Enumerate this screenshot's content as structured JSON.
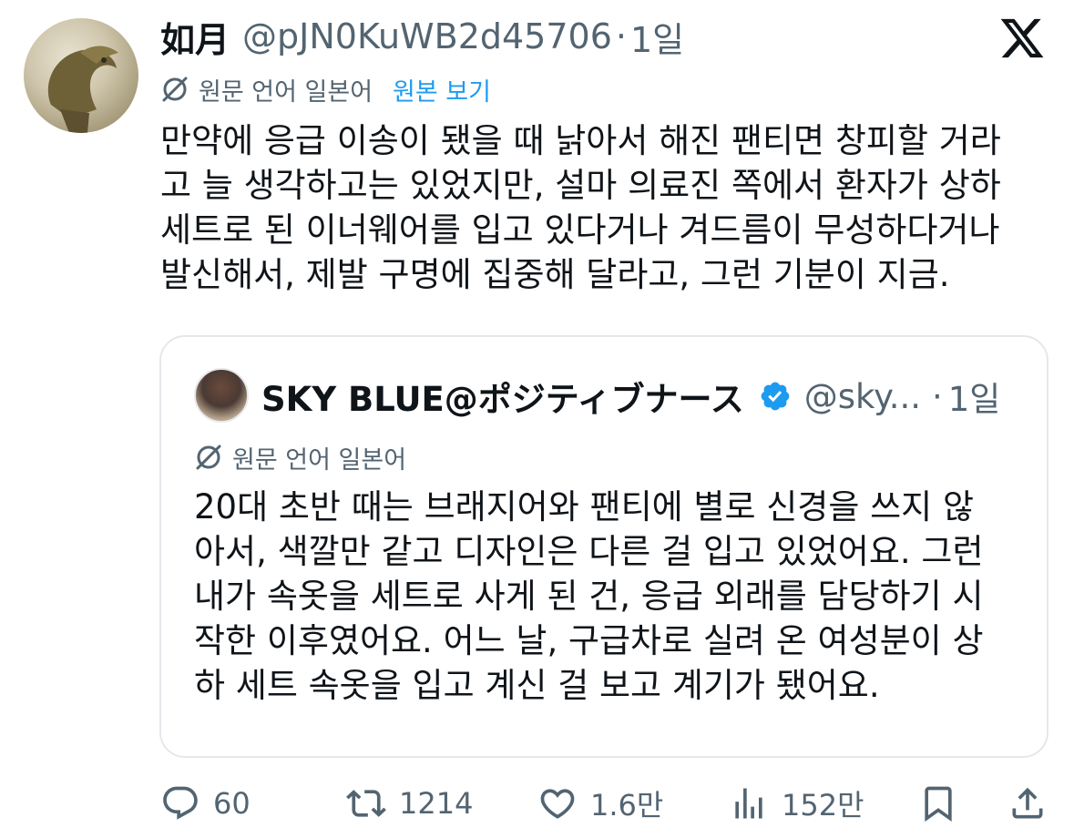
{
  "tweet": {
    "author_name": "如月",
    "handle": "@pJN0KuWB2d45706",
    "separator": "·",
    "time": "1일",
    "translation": {
      "label": "원문 언어 일본어",
      "view_original": "원본 보기"
    },
    "body_lines": [
      "만약에 응급 이송이 됐을 때 낡아서 해진 팬티면 창피할 거라",
      "고 늘 생각하고는 있었지만, 설마 의료진 쪽에서 환자가 상하",
      "세트로 된 이너웨어를 입고 있다거나 겨드름이 무성하다거나",
      "발신해서, 제발 구명에 집중해 달라고, 그런 기분이 지금."
    ]
  },
  "quote": {
    "author_name": "SKY BLUE@ポジティブナース",
    "handle": "@sky...",
    "separator": "·",
    "time": "1일",
    "translation_label": "원문 언어 일본어",
    "body_lines": [
      "20대 초반 때는 브래지어와 팬티에 별로 신경을 쓰지 않",
      "아서, 색깔만 같고 디자인은 다른 걸 입고 있었어요. 그런",
      "내가 속옷을 세트로 사게 된 건, 응급 외래를 담당하기 시",
      "작한 이후였어요. 어느 날, 구급차로 실려 온 여성분이 상",
      "하 세트 속옷을 입고 계신 걸 보고 계기가 됐어요."
    ]
  },
  "actions": {
    "replies": "60",
    "retweets": "1214",
    "likes": "1.6만",
    "views": "152만"
  },
  "colors": {
    "text": "#0f1419",
    "secondary": "#536471",
    "link": "#1d9bf0",
    "verified": "#1d9bf0",
    "border": "#e4e8eb"
  },
  "icons": {
    "brand": "x-logo-icon",
    "translate": "globe-slash-icon",
    "verified": "verified-badge-icon",
    "reply": "reply-icon",
    "retweet": "retweet-icon",
    "like": "heart-icon",
    "views": "views-icon",
    "bookmark": "bookmark-icon",
    "share": "share-icon"
  }
}
